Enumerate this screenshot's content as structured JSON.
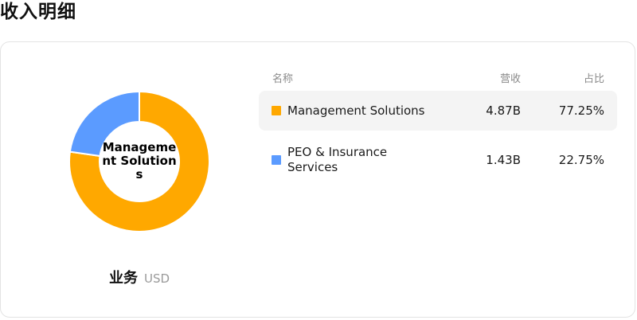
{
  "page_title": "收入明细",
  "donut": {
    "center_label": "Management Solutions",
    "caption": "业务",
    "unit": "USD"
  },
  "table": {
    "headers": {
      "name": "名称",
      "revenue": "营收",
      "share": "占比"
    },
    "rows": [
      {
        "name": "Management Solutions",
        "revenue": "4.87B",
        "share": "77.25%",
        "color": "#FFA800",
        "selected": true
      },
      {
        "name": "PEO & Insurance Services",
        "revenue": "1.43B",
        "share": "22.75%",
        "color": "#5B9BFF",
        "selected": false
      }
    ]
  },
  "chart_data": {
    "type": "pie",
    "categories": [
      "Management Solutions",
      "PEO & Insurance Services"
    ],
    "values": [
      77.25,
      22.75
    ],
    "colors": [
      "#FFA800",
      "#5B9BFF"
    ],
    "title": "",
    "center_label": "Management Solutions"
  }
}
